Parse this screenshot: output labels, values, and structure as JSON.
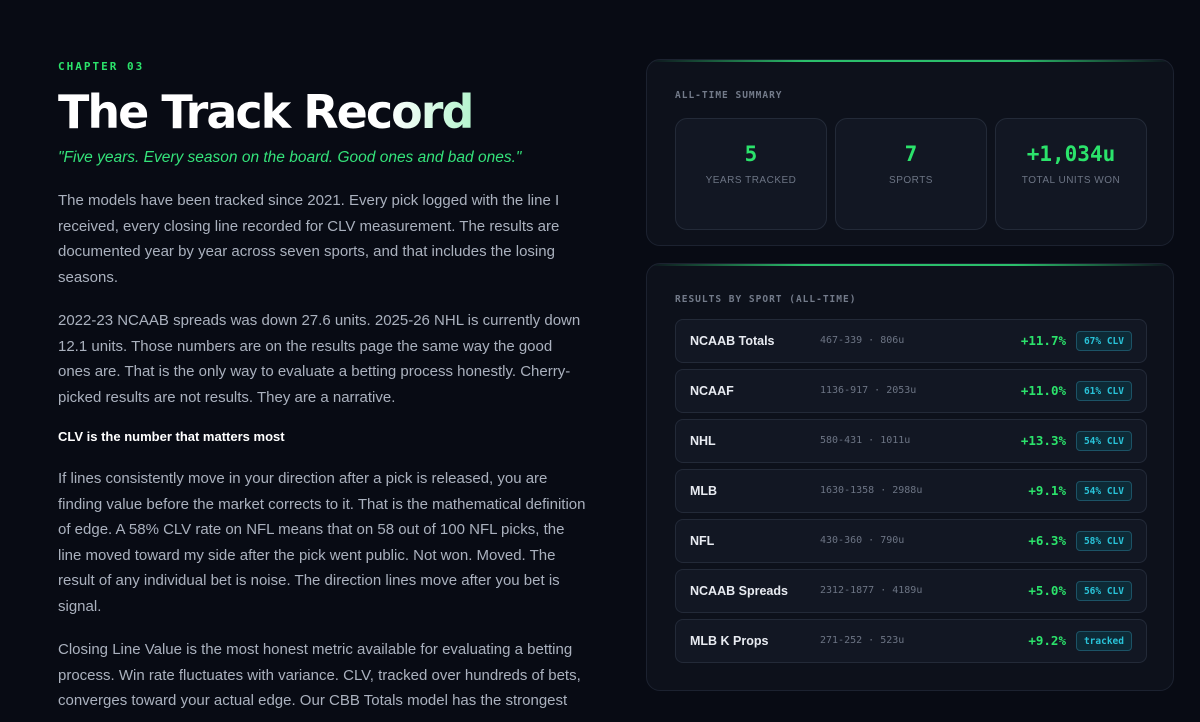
{
  "left": {
    "chapter": "CHAPTER 03",
    "title": "The Track Record",
    "quote": "\"Five years. Every season on the board. Good ones and bad ones.\"",
    "paragraphs": [
      "The models have been tracked since 2021. Every pick logged with the line I received, every closing line recorded for CLV measurement. The results are documented year by year across seven sports, and that includes the losing seasons.",
      "2022-23 NCAAB spreads was down 27.6 units. 2025-26 NHL is currently down 12.1 units. Those numbers are on the results page the same way the good ones are. That is the only way to evaluate a betting process honestly. Cherry-picked results are not results. They are a narrative."
    ],
    "subhead": "CLV is the number that matters most",
    "paragraphs2": [
      "If lines consistently move in your direction after a pick is released, you are finding value before the market corrects to it. That is the mathematical definition of edge. A 58% CLV rate on NFL means that on 58 out of 100 NFL picks, the line moved toward my side after the pick went public. Not won. Moved. The result of any individual bet is noise. The direction lines move after you bet is signal.",
      "Closing Line Value is the most honest metric available for evaluating a betting process. Win rate fluctuates with variance. CLV, tracked over hundreds of bets, converges toward your actual edge. Our CBB Totals model has the strongest"
    ]
  },
  "summary": {
    "label": "ALL-TIME SUMMARY",
    "stats": [
      {
        "value": "5",
        "label": "YEARS TRACKED"
      },
      {
        "value": "7",
        "label": "SPORTS"
      },
      {
        "value": "+1,034u",
        "label": "TOTAL UNITS WON"
      }
    ]
  },
  "results": {
    "label": "RESULTS BY SPORT (ALL-TIME)",
    "rows": [
      {
        "sport": "NCAAB Totals",
        "record": "467-339 · 806u",
        "roi": "+11.7%",
        "badge": "67% CLV"
      },
      {
        "sport": "NCAAF",
        "record": "1136-917 · 2053u",
        "roi": "+11.0%",
        "badge": "61% CLV"
      },
      {
        "sport": "NHL",
        "record": "580-431 · 1011u",
        "roi": "+13.3%",
        "badge": "54% CLV"
      },
      {
        "sport": "MLB",
        "record": "1630-1358 · 2988u",
        "roi": "+9.1%",
        "badge": "54% CLV"
      },
      {
        "sport": "NFL",
        "record": "430-360 · 790u",
        "roi": "+6.3%",
        "badge": "58% CLV"
      },
      {
        "sport": "NCAAB Spreads",
        "record": "2312-1877 · 4189u",
        "roi": "+5.0%",
        "badge": "56% CLV"
      },
      {
        "sport": "MLB K Props",
        "record": "271-252 · 523u",
        "roi": "+9.2%",
        "badge": "tracked"
      }
    ]
  }
}
